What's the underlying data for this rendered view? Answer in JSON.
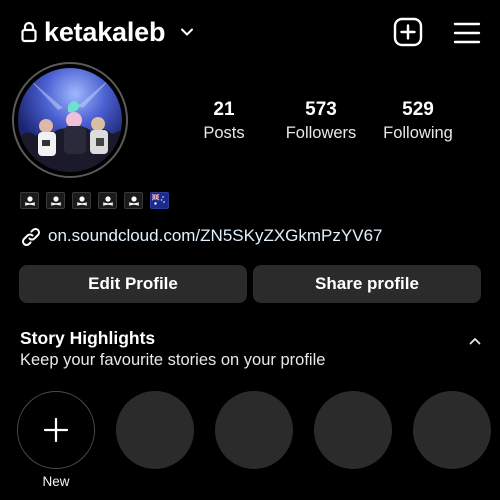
{
  "header": {
    "username": "ketakaleb",
    "icons": [
      "lock-icon",
      "chevron-down-icon",
      "add-icon",
      "menu-icon"
    ]
  },
  "profile": {
    "avatar_icon": "profile-photo",
    "bio_emojis": [
      "pirate-flag",
      "pirate-flag",
      "pirate-flag",
      "pirate-flag",
      "pirate-flag",
      "australia-flag"
    ],
    "link": "on.soundcloud.com/ZN5SKyZXGkmPzYV67"
  },
  "stats": [
    {
      "value": "21",
      "label": "Posts"
    },
    {
      "value": "573",
      "label": "Followers"
    },
    {
      "value": "529",
      "label": "Following"
    }
  ],
  "buttons": {
    "edit": "Edit Profile",
    "share": "Share profile"
  },
  "highlights": {
    "title": "Story Highlights",
    "subtitle": "Keep your favourite stories on your profile",
    "new_label": "New"
  },
  "colors": {
    "background": "#000000",
    "button": "#2b2b2b",
    "placeholder": "#2b2b2b",
    "link": "#e0f1ff"
  }
}
